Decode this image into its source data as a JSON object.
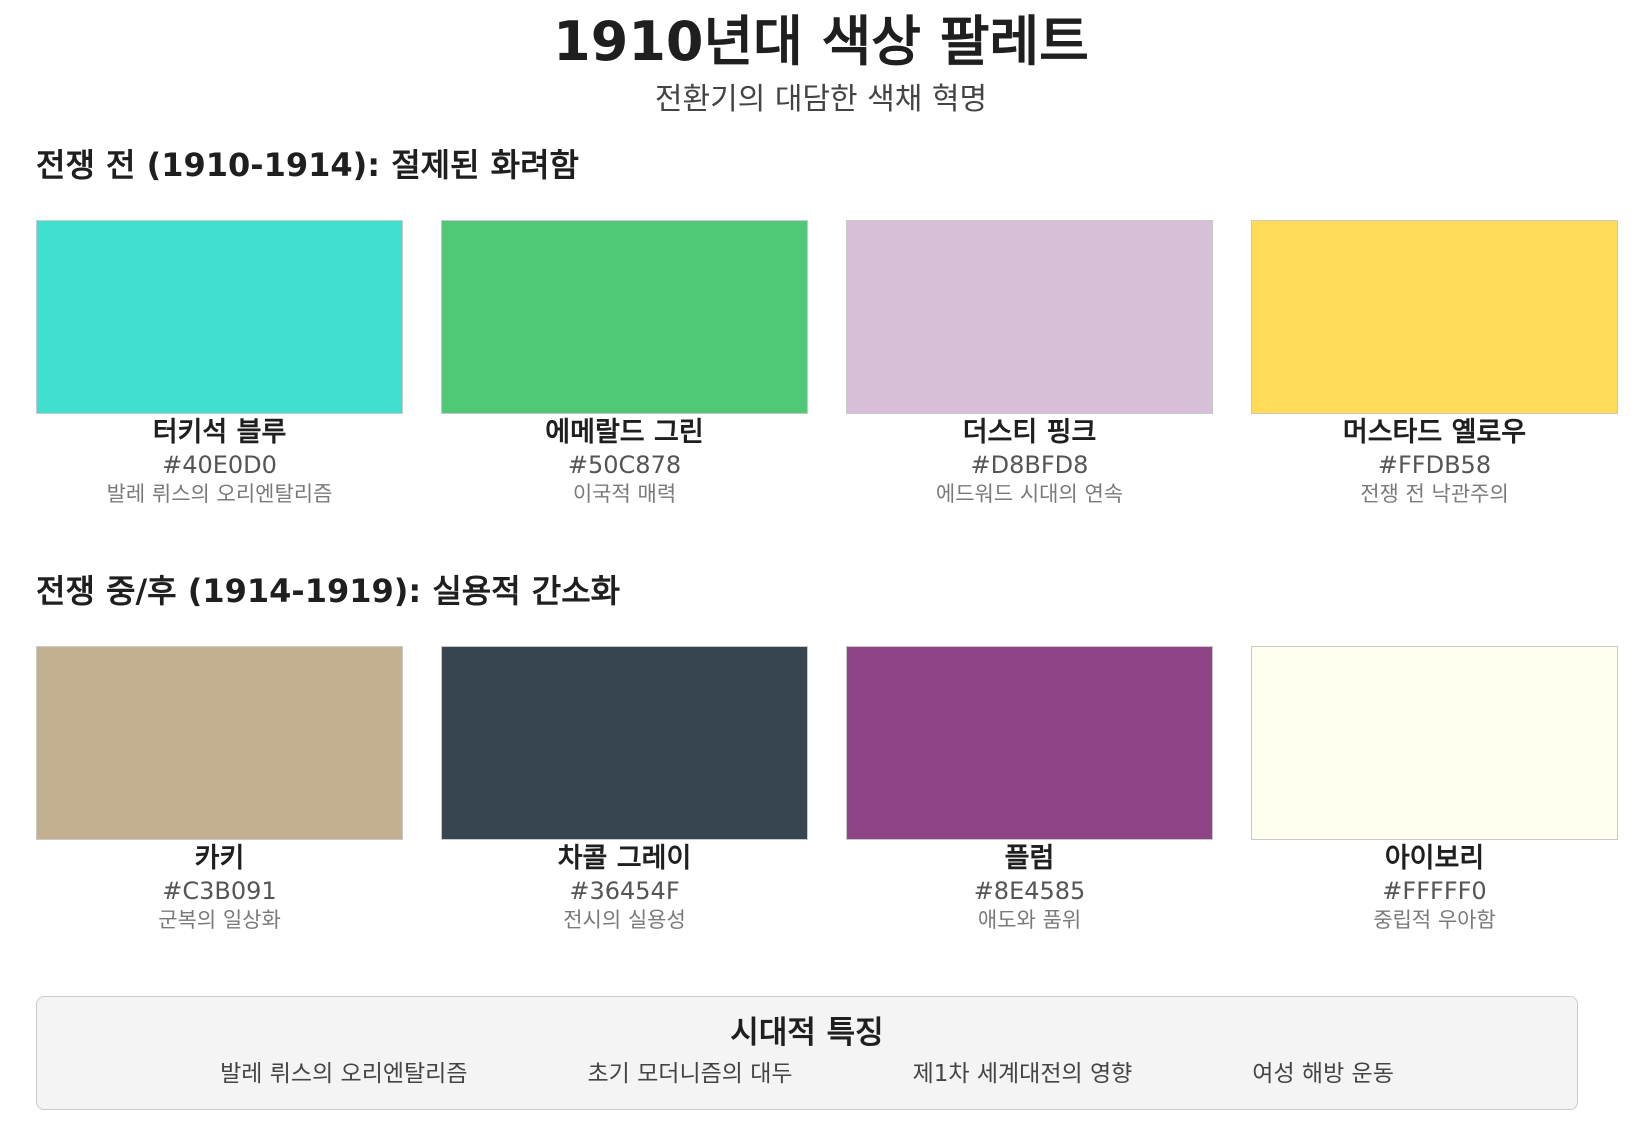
{
  "header": {
    "title": "1910년대 색상 팔레트",
    "subtitle": "전환기의 대담한 색채 혁명"
  },
  "sections": [
    {
      "title": "전쟁 전 (1910-1914): 절제된 화려함",
      "colors": [
        {
          "name": "터키석 블루",
          "hex": "#40E0D0",
          "desc": "발레 뤼스의 오리엔탈리즘",
          "color": "#40E0D0"
        },
        {
          "name": "에메랄드 그린",
          "hex": "#50C878",
          "desc": "이국적 매력",
          "color": "#50C878"
        },
        {
          "name": "더스티 핑크",
          "hex": "#D8BFD8",
          "desc": "에드워드 시대의 연속",
          "color": "#D8BFD8"
        },
        {
          "name": "머스타드 옐로우",
          "hex": "#FFDB58",
          "desc": "전쟁 전 낙관주의",
          "color": "#FFDB58"
        }
      ]
    },
    {
      "title": "전쟁 중/후 (1914-1919): 실용적 간소화",
      "colors": [
        {
          "name": "카키",
          "hex": "#C3B091",
          "desc": "군복의 일상화",
          "color": "#C3B091"
        },
        {
          "name": "차콜 그레이",
          "hex": "#36454F",
          "desc": "전시의 실용성",
          "color": "#36454F"
        },
        {
          "name": "플럼",
          "hex": "#8E4585",
          "desc": "애도와 품위",
          "color": "#8E4585"
        },
        {
          "name": "아이보리",
          "hex": "#FFFFF0",
          "desc": "중립적 우아함",
          "color": "#FFFFF0"
        }
      ]
    }
  ],
  "traits": {
    "title": "시대적 특징",
    "items": [
      "발레 뤼스의 오리엔탈리즘",
      "초기 모더니즘의 대두",
      "제1차 세계대전의 영향",
      "여성 해방 운동"
    ]
  }
}
